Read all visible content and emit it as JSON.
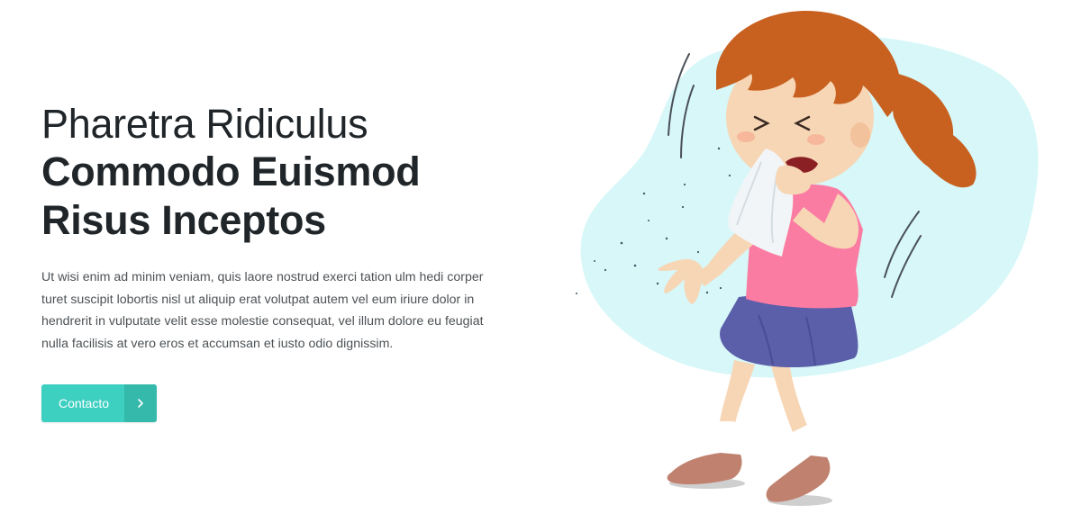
{
  "hero": {
    "title_line1": "Pharetra Ridiculus",
    "title_line2": "Commodo Euismod",
    "title_line3": "Risus Inceptos",
    "body": "Ut wisi enim ad minim veniam, quis laore nostrud exerci tation ulm hedi corper turet suscipit lobortis nisl ut aliquip erat volutpat autem vel eum iriure dolor in hendrerit in vulputate velit esse molestie consequat, vel illum dolore eu feugiat nulla facilisis at vero eros et accumsan et iusto odio dignissim.",
    "cta_label": "Contacto",
    "cta_icon": "chevron-right-icon"
  },
  "illustration": {
    "subject": "sneezing-girl",
    "colors": {
      "blob": "#d7f7f8",
      "hair": "#c8601f",
      "skin": "#f7d6b5",
      "shirt": "#fb7ca2",
      "skirt": "#5b5ea9",
      "shoes": "#c0826f",
      "accent": "#3dcfc0"
    }
  }
}
